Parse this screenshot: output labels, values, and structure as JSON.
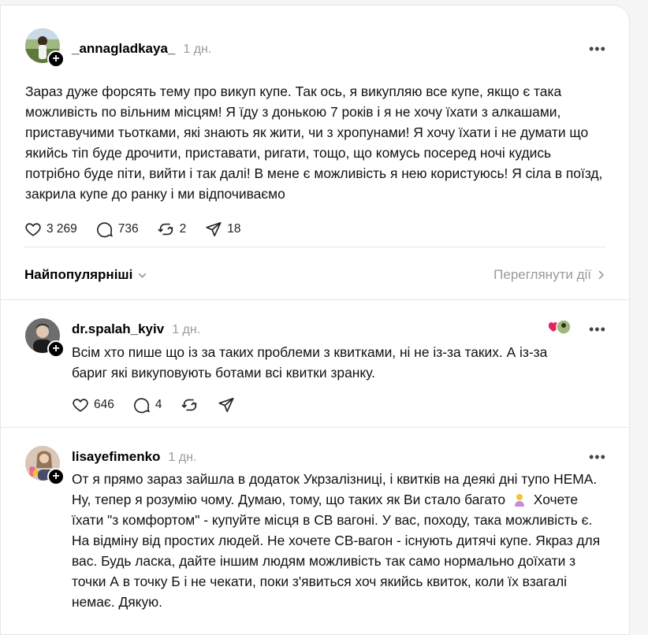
{
  "main_post": {
    "username": "_annagladkaya_",
    "time": "1 дн.",
    "text": "Зараз дуже форсять тему про викуп купе. Так ось, я викупляю все купе, якщо є така можливість по вільним місцям! Я їду з донькою 7 років і я не хочу їхати з алкашами, приставучими тьотками, які знають як жити, чи з хропунами! Я хочу їхати і не думати що якийсь тіп буде дрочити, приставати, ригати, тощо, що комусь посеред ночі кудись потрібно буде піти, вийти і так далі! В мене є можливість я нею користуюсь! Я сіла в поїзд, закрила купе до ранку і ми відпочиваємо",
    "likes": "3 269",
    "replies": "736",
    "reposts": "2",
    "shares": "18"
  },
  "sort": {
    "label": "Найпопулярніші",
    "view_activity": "Переглянути дії"
  },
  "replies": [
    {
      "username": "dr.spalah_kyiv",
      "time": "1 дн.",
      "text": "Всім хто пише що із за таких проблеми з квитками, ні не із-за таких. А із-за бариг які викуповують ботами всі квитки зранку.",
      "likes": "646",
      "replies": "4",
      "reposts": "",
      "shares": ""
    },
    {
      "username": "lisayefimenko",
      "time": "1 дн.",
      "text_before_emoji": "От я прямо зараз зайшла в додаток Укрзалізниці, і квитків на деякі дні тупо НЕМА. Ну, тепер я розумію чому. Думаю, тому, що таких як Ви стало багато",
      "text_after_emoji": "Хочете їхати \"з комфортом\" - купуйте місця в СВ вагоні. У вас, походу, така можливість є. На відміну від простих людей. Не хочете СВ-вагон - існують дитячі купе. Якраз для вас. Будь ласка, дайте іншим людям можливість так само нормально доїхати з точки А в точку Б і не чекати, поки з'явиться хоч якийсь квиток, коли їх взагалі немає. Дякую."
    }
  ],
  "icons": {
    "like": "heart-icon",
    "reply": "comment-icon",
    "repost": "repost-icon",
    "share": "send-icon",
    "more": "more-icon",
    "follow": "plus-icon"
  },
  "colors": {
    "liked_heart": "#e0245e"
  }
}
